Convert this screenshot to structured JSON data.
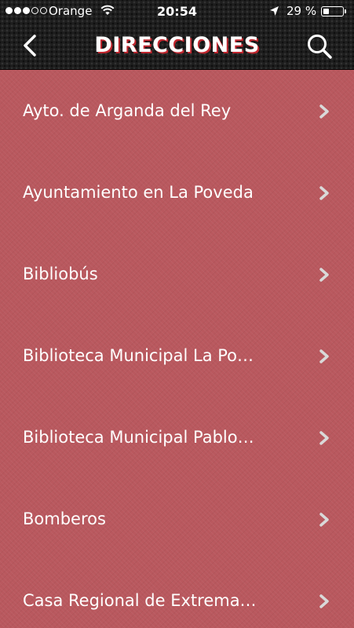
{
  "status_bar": {
    "carrier": "Orange",
    "time": "20:54",
    "battery_percent": "29 %",
    "battery_level": 0.29,
    "signal_bars_filled": 3,
    "signal_bars_total": 5,
    "icons": [
      "wifi-icon",
      "location-arrow-icon",
      "battery-icon"
    ]
  },
  "nav": {
    "title": "DIRECCIONES",
    "back_icon": "chevron-left-icon",
    "search_icon": "search-icon"
  },
  "list": {
    "items": [
      {
        "label": "Ayto. de Arganda del Rey"
      },
      {
        "label": "Ayuntamiento en La Poveda"
      },
      {
        "label": "Bibliobús"
      },
      {
        "label": "Biblioteca Municipal La Po…"
      },
      {
        "label": "Biblioteca Municipal Pablo…"
      },
      {
        "label": "Bomberos"
      },
      {
        "label": "Casa Regional de Extrema…"
      }
    ],
    "chevron_icon": "chevron-right-icon"
  },
  "colors": {
    "background": "#b9585e",
    "topbar": "#1e1e1e",
    "title_shadow": "#c0262e",
    "text": "#ffffff",
    "chevron": "#d9d9d9"
  }
}
